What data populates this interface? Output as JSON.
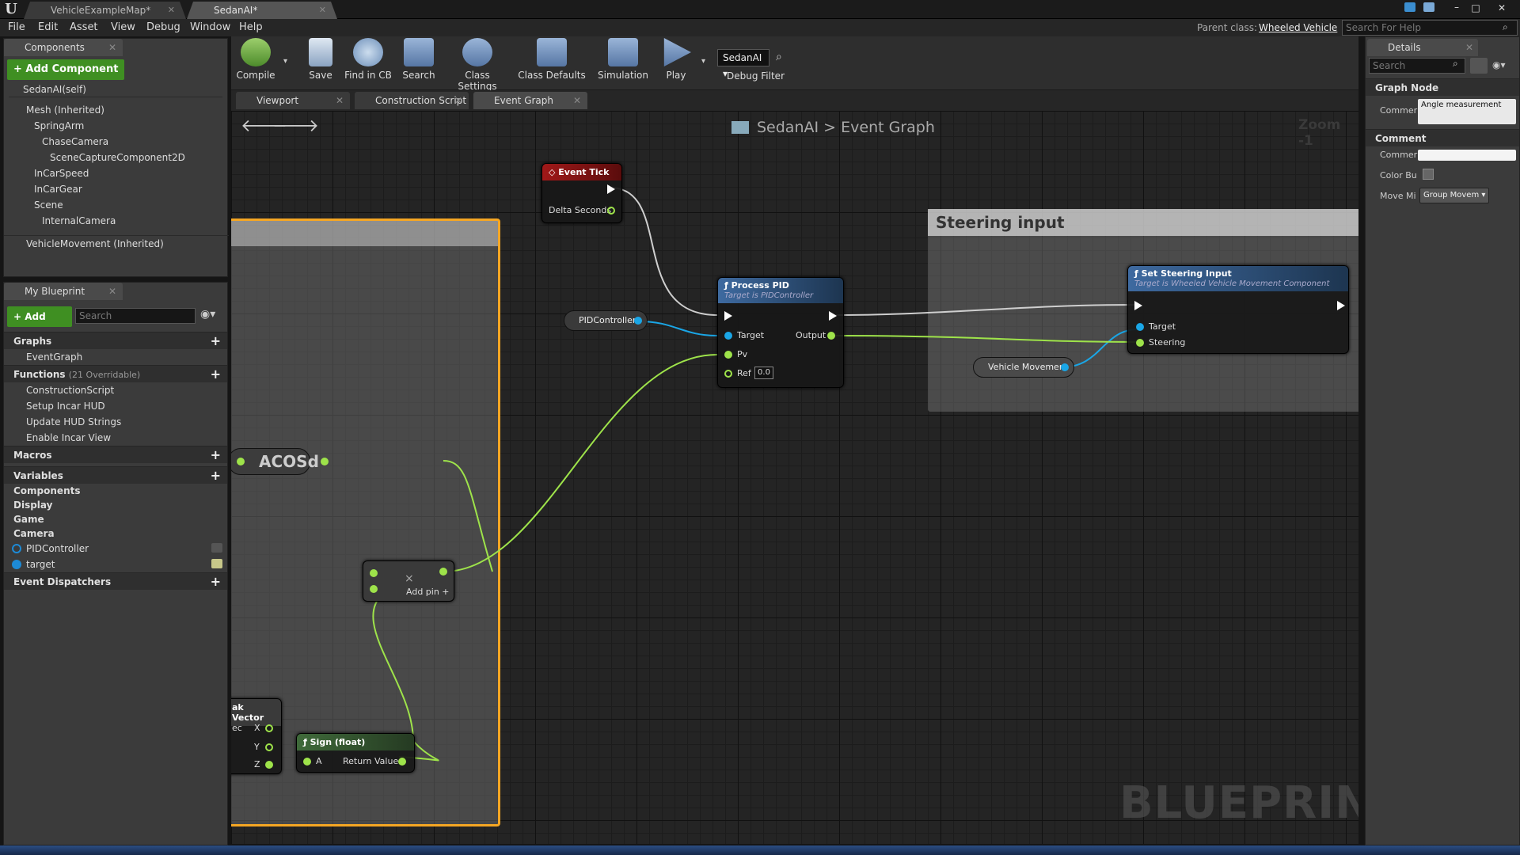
{
  "window": {
    "tabs": [
      {
        "label": "VehicleExampleMap*"
      },
      {
        "label": "SedanAI*"
      }
    ]
  },
  "menu": [
    "File",
    "Edit",
    "Asset",
    "View",
    "Debug",
    "Window",
    "Help"
  ],
  "parent_class": {
    "label": "Parent class:",
    "value": "Wheeled Vehicle"
  },
  "help_search": {
    "placeholder": "Search For Help"
  },
  "toolbar": {
    "compile": "Compile",
    "save": "Save",
    "find_in_cb": "Find in CB",
    "search": "Search",
    "class_settings": "Class Settings",
    "class_defaults": "Class Defaults",
    "simulation": "Simulation",
    "play": "Play",
    "debug_object": "SedanAI",
    "debug_filter": "Debug Filter"
  },
  "components_panel": {
    "tab": "Components",
    "add_button": "+ Add Component",
    "self": "SedanAI(self)",
    "tree": [
      {
        "label": "Mesh (Inherited)",
        "indent": 0
      },
      {
        "label": "SpringArm",
        "indent": 1
      },
      {
        "label": "ChaseCamera",
        "indent": 2
      },
      {
        "label": "SceneCaptureComponent2D",
        "indent": 3
      },
      {
        "label": "InCarSpeed",
        "indent": 1
      },
      {
        "label": "InCarGear",
        "indent": 1
      },
      {
        "label": "Scene",
        "indent": 1
      },
      {
        "label": "InternalCamera",
        "indent": 2
      }
    ],
    "movement": "VehicleMovement (Inherited)"
  },
  "my_blueprint": {
    "tab": "My Blueprint",
    "add_new": "+ Add New",
    "search_placeholder": "Search",
    "graphs_header": "Graphs",
    "graphs": [
      "EventGraph"
    ],
    "functions_header": "Functions",
    "functions_count": "(21 Overridable)",
    "functions": [
      "ConstructionScript",
      "Setup Incar HUD",
      "Update HUD Strings",
      "Enable Incar View"
    ],
    "macros_header": "Macros",
    "variables_header": "Variables",
    "variable_groups": [
      "Components",
      "Display",
      "Game",
      "Camera"
    ],
    "variables": [
      {
        "name": "PIDController",
        "color": "#1d8ad6"
      },
      {
        "name": "target",
        "color": "#1d8ad6"
      }
    ],
    "dispatchers_header": "Event Dispatchers"
  },
  "editor_tabs": [
    {
      "label": "Viewport"
    },
    {
      "label": "Construction Script"
    },
    {
      "label": "Event Graph"
    }
  ],
  "graph": {
    "breadcrumb_root": "SedanAI",
    "breadcrumb_sep": ">",
    "breadcrumb_current": "Event Graph",
    "zoom": "Zoom -1",
    "watermark": "BLUEPRINT",
    "comment_steering": "Steering input",
    "nodes": {
      "event_tick": {
        "title": "Event Tick",
        "pin": "Delta Seconds"
      },
      "pid_var": {
        "label": "PIDController"
      },
      "process_pid": {
        "title": "Process PID",
        "subtitle": "Target is PIDController",
        "in_target": "Target",
        "in_pv": "Pv",
        "in_ref": "Ref",
        "ref_value": "0.0",
        "out": "Output"
      },
      "set_steering": {
        "title": "Set Steering Input",
        "subtitle": "Target is Wheeled Vehicle Movement Component",
        "in_target": "Target",
        "in_steering": "Steering"
      },
      "vm_var": {
        "label": "Vehicle Movement"
      },
      "acosd": {
        "label": "ACOSd"
      },
      "multiply": {
        "symbol": "×",
        "add_pin": "Add pin +"
      },
      "break_vector": {
        "title": "ak Vector",
        "in": "ec",
        "x": "X",
        "y": "Y",
        "z": "Z"
      },
      "sign": {
        "title": "Sign (float)",
        "in": "A",
        "out": "Return Value"
      }
    }
  },
  "details": {
    "tab": "Details",
    "search_placeholder": "Search",
    "graph_node_header": "Graph Node",
    "comment_label": "Commer",
    "comment_value": "Angle measurement",
    "comment_header": "Comment",
    "comment2_label": "Commer",
    "color_label": "Color Bu",
    "move_label": "Move Mi",
    "move_value": "Group Movem"
  },
  "colors": {
    "accent_green": "#3f8f22",
    "float_pin": "#9ee34a",
    "object_pin": "#1aa6e6",
    "event_red": "#8c1515",
    "comment_border": "#f5a623"
  }
}
